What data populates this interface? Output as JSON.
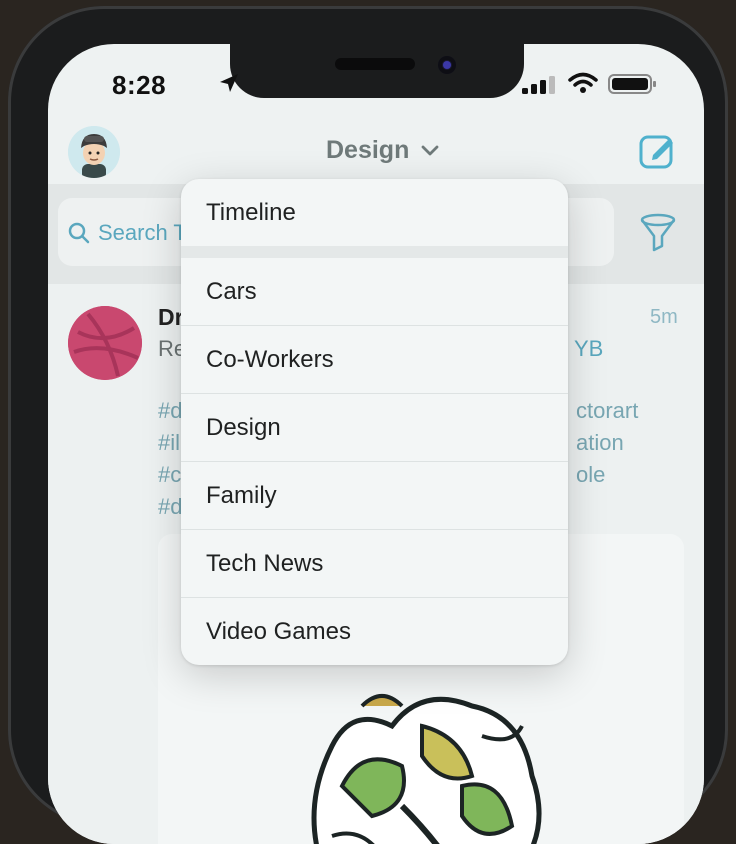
{
  "status_bar": {
    "time": "8:28"
  },
  "nav": {
    "title": "Design"
  },
  "search": {
    "placeholder": "Search T"
  },
  "tweet": {
    "name": "Dri",
    "line1": "Re",
    "link_fragment": "YB",
    "time": "5m",
    "tags_left": [
      "#d",
      "#ill",
      "#c",
      "#d"
    ],
    "tags_right": [
      "ctorart",
      "ation",
      "ole"
    ]
  },
  "menu": {
    "items": [
      "Timeline",
      "Cars",
      "Co-Workers",
      "Design",
      "Family",
      "Tech News",
      "Video Games"
    ]
  },
  "colors": {
    "accent": "#5aa7be",
    "menu_bg": "#f3f6f6",
    "dribbble_pink": "#c9486f"
  },
  "icons": [
    "location-arrow-icon",
    "signal-icon",
    "wifi-icon",
    "battery-icon",
    "chevron-down-icon",
    "compose-icon",
    "search-icon",
    "filter-icon"
  ]
}
